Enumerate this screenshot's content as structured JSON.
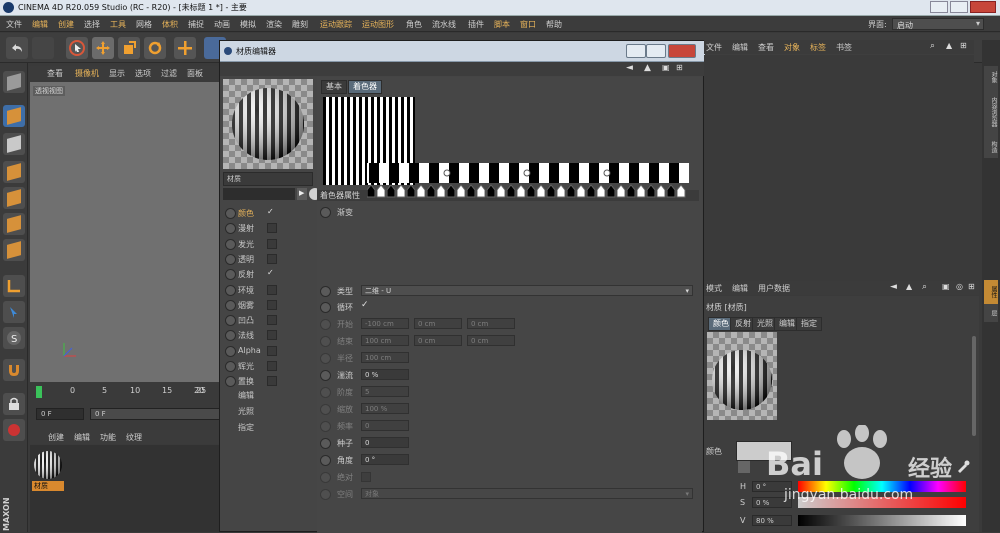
{
  "window": {
    "title": "CINEMA 4D R20.059 Studio (RC - R20) - [未标题 1 *] - 主要"
  },
  "menubar": {
    "items": [
      "文件",
      "编辑",
      "创建",
      "选择",
      "工具",
      "网格",
      "体积",
      "捕捉",
      "动画",
      "模拟",
      "渲染",
      "雕刻",
      "运动跟踪",
      "运动图形",
      "角色",
      "流水线",
      "插件",
      "脚本",
      "窗口",
      "帮助"
    ],
    "layout_label": "界面:",
    "layout_value": "启动"
  },
  "viewport": {
    "menu": [
      "查看",
      "摄像机",
      "显示",
      "选项",
      "过滤",
      "面板"
    ],
    "label": "透视视图"
  },
  "timeline": {
    "ticks": [
      "0",
      "5",
      "10",
      "15",
      "20",
      "25"
    ],
    "frame_start": "0 F",
    "frame_current": "0 F"
  },
  "material_manager": {
    "menu": [
      "创建",
      "编辑",
      "功能",
      "纹理"
    ],
    "material_name": "材质"
  },
  "material_editor": {
    "title": "材质编辑器",
    "name": "材质",
    "tabs": [
      "基本",
      "着色器"
    ],
    "active_tab": "着色器",
    "channels": [
      {
        "label": "颜色",
        "checked": true,
        "selected": true
      },
      {
        "label": "漫射",
        "checked": false
      },
      {
        "label": "发光",
        "checked": false
      },
      {
        "label": "透明",
        "checked": false
      },
      {
        "label": "反射",
        "checked": true
      },
      {
        "label": "环境",
        "checked": false
      },
      {
        "label": "烟雾",
        "checked": false
      },
      {
        "label": "凹凸",
        "checked": false
      },
      {
        "label": "法线",
        "checked": false
      },
      {
        "label": "Alpha",
        "checked": false
      },
      {
        "label": "辉光",
        "checked": false
      },
      {
        "label": "置换",
        "checked": false
      }
    ],
    "sub_items": [
      "编辑",
      "光照",
      "指定"
    ],
    "section_title": "着色器属性",
    "gradient_label": "渐变",
    "params": {
      "type_label": "类型",
      "type_value": "二维 - U",
      "cycle_label": "循环",
      "start_label": "开始",
      "start_values": [
        "-100 cm",
        "0 cm",
        "0 cm"
      ],
      "end_label": "结束",
      "end_values": [
        "100 cm",
        "0 cm",
        "0 cm"
      ],
      "radius_label": "半径",
      "radius_value": "100 cm",
      "turbulence_label": "湍流",
      "turbulence_value": "0 %",
      "octaves_label": "阶度",
      "octaves_value": "5",
      "scale_label": "缩放",
      "scale_value": "100 %",
      "frequency_label": "频率",
      "frequency_value": "0",
      "seed_label": "种子",
      "seed_value": "0",
      "angle_label": "角度",
      "angle_value": "0 °",
      "absolute_label": "绝对",
      "space_label": "空间",
      "space_value": "对象"
    }
  },
  "object_manager": {
    "menu": [
      "文件",
      "编辑",
      "查看",
      "对象",
      "标签",
      "书签"
    ]
  },
  "attribute_manager": {
    "menu": [
      "模式",
      "编辑",
      "用户数据"
    ],
    "title": "材质 [材质]",
    "tabs": [
      "颜色",
      "反射",
      "光照",
      "编辑",
      "指定"
    ],
    "color_label": "颜色",
    "h_label": "H",
    "h_value": "0 °",
    "s_label": "S",
    "s_value": "0 %",
    "v_label": "V",
    "v_value": "80 %"
  },
  "right_strip": {
    "tabs": [
      "对象",
      "内容浏览器",
      "构造",
      "属性",
      "层"
    ]
  },
  "watermark": {
    "brand": "Bai",
    "brand2": "经验",
    "url": "jingyan.baidu.com"
  }
}
